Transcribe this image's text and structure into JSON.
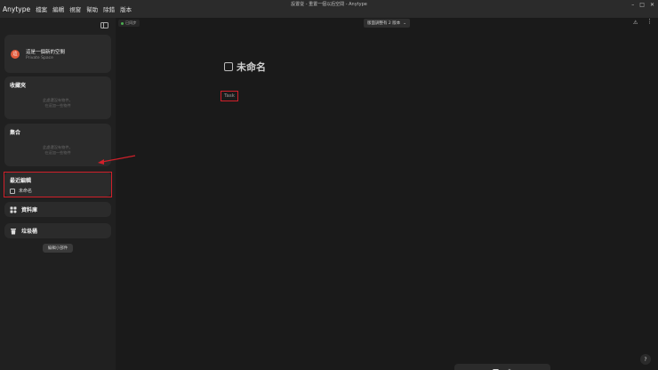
{
  "window": {
    "title": "設置從 - 重置一個以后空間 - Anytype"
  },
  "menubar": {
    "app_name": "Anytype",
    "items": [
      "檔案",
      "編輯",
      "視窗",
      "幫助",
      "除錯",
      "版本"
    ]
  },
  "sidebar": {
    "space": {
      "name": "這是一個新的空間",
      "subtitle": "Private Space",
      "avatar_letter": "這"
    },
    "favorites": {
      "title": "收藏夾",
      "empty_line1": "此處還沒有物件，",
      "empty_line2": "在這加一些物件"
    },
    "collections": {
      "title": "集合",
      "empty_line1": "此處還沒有物件，",
      "empty_line2": "在這加一些物件"
    },
    "recent": {
      "title": "最近編輯",
      "items": [
        {
          "label": "未命名"
        }
      ]
    },
    "library": {
      "label": "資料庫",
      "icon": "library-icon"
    },
    "trash": {
      "label": "垃圾桶",
      "icon": "trash-icon"
    },
    "edit_widgets_label": "編輯小部件"
  },
  "header": {
    "sync_status": "已同步",
    "version_button": "版面調整有 2 版本",
    "warning_icon": "warning-icon",
    "more_icon": "more-icon"
  },
  "document": {
    "title": "未命名",
    "type": "Task"
  },
  "bottom_bar": {
    "icons": [
      "back-icon",
      "forward-icon",
      "plus-icon",
      "graph-icon",
      "search-icon",
      "settings-icon"
    ]
  },
  "help_label": "?",
  "colors": {
    "annotation_red": "#d0202a",
    "sync_green": "#4caf50",
    "avatar": "#e05a3b"
  }
}
